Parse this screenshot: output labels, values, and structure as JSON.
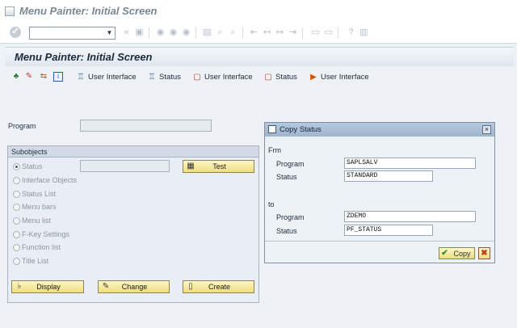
{
  "window": {
    "title": "Menu Painter: Initial Screen"
  },
  "std_toolbar": {
    "command_field_value": "",
    "icons": [
      "enter-icon",
      "save-icon",
      "back-icon",
      "exit-icon",
      "cancel-icon",
      "print-icon",
      "find-icon",
      "find-next-icon",
      "first-page-icon",
      "prev-page-icon",
      "next-page-icon",
      "last-page-icon",
      "new-session-icon",
      "shortcut-icon",
      "help-icon",
      "layout-icon"
    ]
  },
  "screen": {
    "title": "Menu Painter: Initial Screen"
  },
  "app_toolbar": {
    "items": [
      {
        "label": "User Interface",
        "icon": "hierarchy-icon"
      },
      {
        "label": "Status",
        "icon": "hierarchy-icon"
      },
      {
        "label": "User Interface",
        "icon": "copy-object-icon"
      },
      {
        "label": "Status",
        "icon": "copy-object-icon"
      },
      {
        "label": "User Interface",
        "icon": "translate-icon"
      }
    ]
  },
  "main": {
    "program_label": "Program",
    "program_value": "",
    "subobjects": {
      "title": "Subobjects",
      "radios": [
        {
          "label": "Status",
          "selected": true
        },
        {
          "label": "Interface Objects",
          "selected": false
        },
        {
          "label": "Status List",
          "selected": false
        },
        {
          "label": "Menu bars",
          "selected": false
        },
        {
          "label": "Menu list",
          "selected": false
        },
        {
          "label": "F-Key Settings",
          "selected": false
        },
        {
          "label": "Function list",
          "selected": false
        },
        {
          "label": "Title List",
          "selected": false
        }
      ],
      "status_value": "",
      "test_label": "Test",
      "display_label": "Display",
      "change_label": "Change",
      "create_label": "Create"
    }
  },
  "dialog": {
    "title": "Copy Status",
    "from_label": "Frm",
    "to_label": "to",
    "from_program_label": "Program",
    "from_program_value": "SAPLSALV",
    "from_status_label": "Status",
    "from_status_value": "STANDARD",
    "to_program_label": "Program",
    "to_program_value": "ZDEMO",
    "to_status_label": "Status",
    "to_status_value": "PF_STATUS",
    "copy_label": "Copy"
  },
  "colors": {
    "button_yellow": "#efdd7e",
    "dialog_header": "#9fb5cc",
    "background": "#eef2f7"
  }
}
